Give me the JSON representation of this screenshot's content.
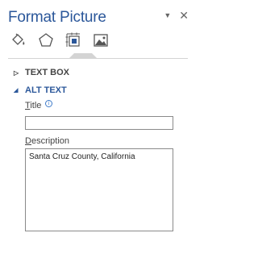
{
  "pane": {
    "title": "Format Picture",
    "dropdown_icon": "triangle-down",
    "close_icon": "x-mark"
  },
  "tabs": [
    {
      "name": "fill-line",
      "icon": "paint-bucket"
    },
    {
      "name": "effects",
      "icon": "pentagon"
    },
    {
      "name": "size-properties",
      "icon": "layout-size",
      "selected": true
    },
    {
      "name": "picture",
      "icon": "mountain-image"
    }
  ],
  "sections": {
    "text_box": {
      "label": "TEXT BOX",
      "expanded": false
    },
    "alt_text": {
      "label": "ALT TEXT",
      "expanded": true
    }
  },
  "alt_text": {
    "title_label_first": "T",
    "title_label_rest": "itle",
    "title_value": "",
    "description_label_first": "D",
    "description_label_rest": "escription",
    "description_value": "Santa Cruz County, California"
  },
  "colors": {
    "accent": "#2b579a",
    "border": "#8a8a8a"
  }
}
